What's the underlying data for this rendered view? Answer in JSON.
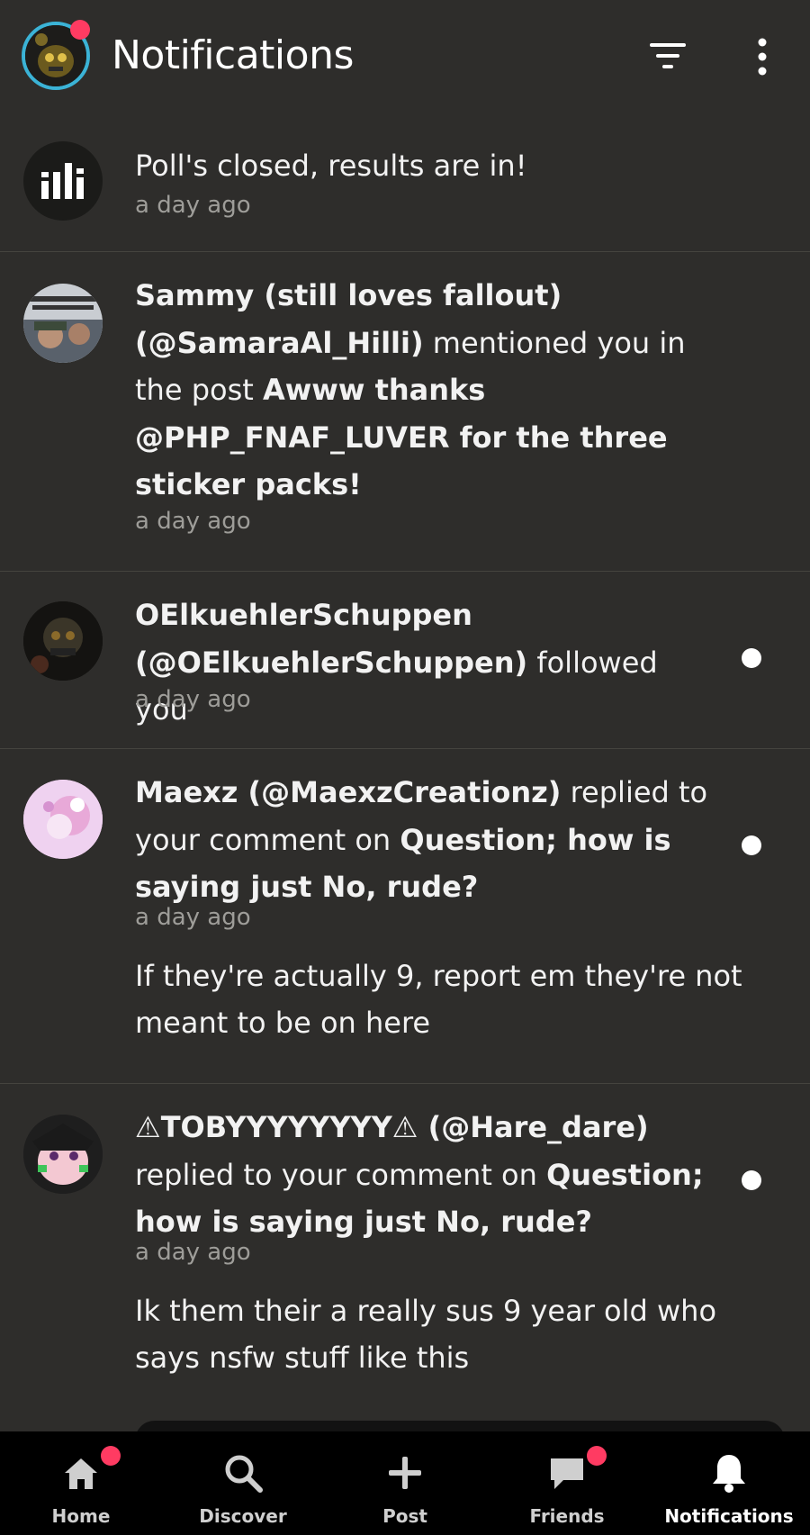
{
  "header": {
    "title": "Notifications",
    "filter_icon": "filter-icon",
    "more_icon": "more-vertical-icon"
  },
  "notifications": [
    {
      "avatar": "poll-icon",
      "text_parts": [
        "Poll's closed, results are in!"
      ],
      "time": "a day ago",
      "unread": false
    },
    {
      "avatar": "user-avatar",
      "lines": [
        {
          "b1": "Sammy (still loves fallout)"
        },
        {
          "b1": "(@SamaraAl_Hilli)",
          "t1": " mentioned you in"
        },
        {
          "t1": "the post ",
          "b1": "Awww thanks"
        },
        {
          "b1": "@PHP_FNAF_LUVER for the three"
        },
        {
          "b1": "sticker packs!"
        }
      ],
      "time": "a day ago",
      "unread": false
    },
    {
      "avatar": "user-avatar",
      "lines": [
        {
          "b1": "OElkuehlerSchuppen"
        },
        {
          "b1": "(@OElkuehlerSchuppen)",
          "t1": " followed you"
        }
      ],
      "time": "a day ago",
      "unread": true
    },
    {
      "avatar": "user-avatar",
      "lines": [
        {
          "b1": "Maexz (@MaexzCreationz)",
          "t1": " replied to"
        },
        {
          "t1": "your comment on ",
          "b1": "Question; how is"
        },
        {
          "b1": "saying just No, rude?"
        }
      ],
      "time": "a day ago",
      "comment_lines": [
        "If they're actually 9, report em they're not",
        "meant to be on here"
      ],
      "unread": true
    },
    {
      "avatar": "user-avatar",
      "lines": [
        {
          "b1": "⚠TOBYYYYYYYY⚠ (@Hare_dare)"
        },
        {
          "t1": "replied to your comment on ",
          "b1": "Question;"
        },
        {
          "b1": "how is saying just No, rude?"
        }
      ],
      "time": "a day ago",
      "comment_lines": [
        "Ik them their a really sus 9 year old who",
        "says nsfw stuff like this"
      ],
      "unread": true
    }
  ],
  "tabs": [
    {
      "label": "Home",
      "icon": "home-icon",
      "badge": true,
      "active": false
    },
    {
      "label": "Discover",
      "icon": "search-icon",
      "badge": false,
      "active": false
    },
    {
      "label": "Post",
      "icon": "plus-icon",
      "badge": false,
      "active": false
    },
    {
      "label": "Friends",
      "icon": "chat-icon",
      "badge": true,
      "active": false
    },
    {
      "label": "Notifications",
      "icon": "bell-icon",
      "badge": false,
      "active": true
    }
  ],
  "colors": {
    "background": "#2e2d2b",
    "accent_badge": "#ff3b62",
    "ring": "#3bb3d6",
    "tabbar": "#000000"
  }
}
